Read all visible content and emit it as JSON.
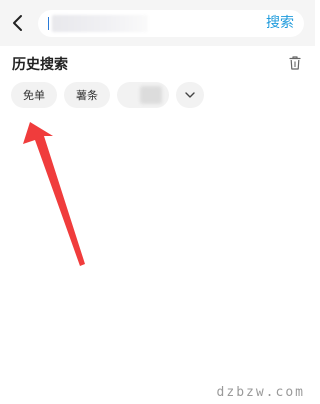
{
  "search": {
    "value": "",
    "submit_label": "搜索"
  },
  "history": {
    "title": "历史搜索",
    "chips": [
      {
        "label": "免单"
      },
      {
        "label": "薯条"
      },
      {
        "label": ""
      }
    ]
  },
  "icons": {
    "back": "chevron-left-icon",
    "trash": "trash-icon",
    "expand": "chevron-down-icon"
  },
  "colors": {
    "accent": "#1f9bdc",
    "annotation_arrow": "#f03c3c"
  },
  "watermark": "dzbzw.com"
}
